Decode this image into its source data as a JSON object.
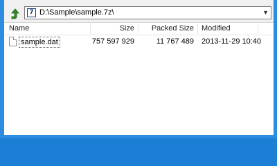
{
  "address": {
    "path": "D:\\Sample\\sample.7z\\",
    "archive_icon_label": "7",
    "up_icon": "up-arrow-icon",
    "dropdown_icon": "chevron-down-icon"
  },
  "columns": {
    "name": "Name",
    "size": "Size",
    "packed_size": "Packed Size",
    "modified": "Modified"
  },
  "files": [
    {
      "name": "sample.dat",
      "size": "757 597 929",
      "packed_size": "11 767 489",
      "modified": "2013-11-29 10:40",
      "icon": "file-icon"
    }
  ],
  "colors": {
    "window_frame": "#1c7fd6",
    "toolbar_bg": "#f0f0f0",
    "list_bg": "#ffffff",
    "up_arrow_green": "#2e8b1e"
  }
}
